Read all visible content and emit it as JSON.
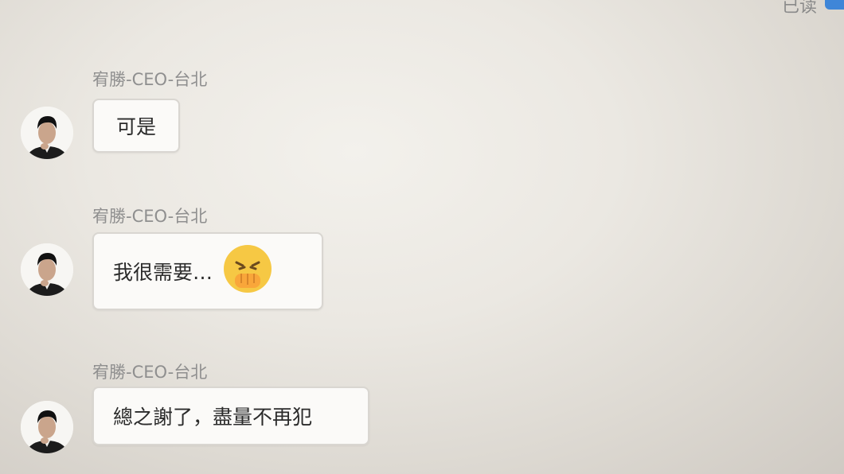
{
  "header": {
    "read_status": "已读"
  },
  "messages": [
    {
      "sender": "宥勝-CEO-台北",
      "text": "可是",
      "avatar_icon": "person-avatar-icon"
    },
    {
      "sender": "宥勝-CEO-台北",
      "text": "我很需要…",
      "emoji": "nauseated-face-emoji",
      "avatar_icon": "person-avatar-icon"
    },
    {
      "sender": "宥勝-CEO-台北",
      "text": "總之謝了，盡量不再犯",
      "avatar_icon": "person-avatar-icon"
    }
  ],
  "colors": {
    "accent": "#3f86d8",
    "bubble_bg": "#fbfaf8",
    "bubble_border": "#d9d6d1",
    "sender_text": "#8f8f8f",
    "emoji_yellow": "#f6c844"
  }
}
